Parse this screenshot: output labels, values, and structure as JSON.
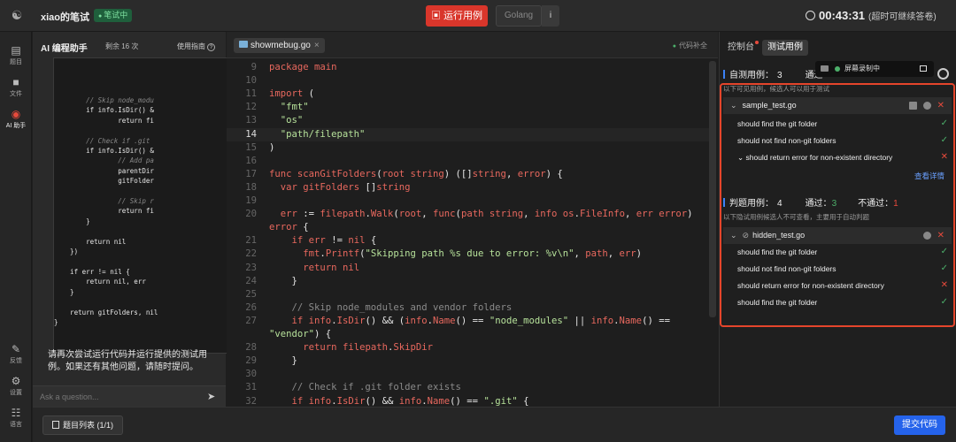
{
  "header": {
    "app_title": "xiao的笔试",
    "badge": "笔试中",
    "run_label": "运行用例",
    "language": "Golang",
    "info": "i",
    "timer": "00:43:31",
    "timer_note": "(超时可继续答卷)"
  },
  "sidebar": {
    "items": [
      {
        "label": "题目",
        "icon": "document-icon"
      },
      {
        "label": "文件",
        "icon": "folder-icon"
      },
      {
        "label": "AI 助手",
        "icon": "robot-icon"
      },
      {
        "label": "反馈",
        "icon": "feedback-icon"
      },
      {
        "label": "设置",
        "icon": "gear-icon"
      },
      {
        "label": "语言",
        "icon": "language-icon"
      }
    ]
  },
  "ai": {
    "title": "AI 编程助手",
    "remaining": "剩余 16 次",
    "guide": "使用指南",
    "code_lines": [
      {
        "text": "        // Skip node_modu",
        "cls": "c"
      },
      {
        "text": "        if info.IsDir() &",
        "cls": ""
      },
      {
        "text": "                return fi",
        "cls": ""
      },
      {
        "text": "",
        "cls": ""
      },
      {
        "text": "        // Check if .git",
        "cls": "c"
      },
      {
        "text": "        if info.IsDir() &",
        "cls": ""
      },
      {
        "text": "                // Add pa",
        "cls": "c"
      },
      {
        "text": "                parentDir",
        "cls": ""
      },
      {
        "text": "                gitFolder",
        "cls": ""
      },
      {
        "text": "",
        "cls": ""
      },
      {
        "text": "                // Skip r",
        "cls": "c"
      },
      {
        "text": "                return fi",
        "cls": ""
      },
      {
        "text": "        }",
        "cls": ""
      },
      {
        "text": "",
        "cls": ""
      },
      {
        "text": "        return nil",
        "cls": ""
      },
      {
        "text": "    })",
        "cls": ""
      },
      {
        "text": "",
        "cls": ""
      },
      {
        "text": "    if err != nil {",
        "cls": ""
      },
      {
        "text": "        return nil, err",
        "cls": ""
      },
      {
        "text": "    }",
        "cls": ""
      },
      {
        "text": "",
        "cls": ""
      },
      {
        "text": "    return gitFolders, nil",
        "cls": ""
      },
      {
        "text": "}",
        "cls": ""
      }
    ],
    "message": "请再次尝试运行代码并运行提供的测试用例。如果还有其他问题，请随时提问。",
    "input_placeholder": "Ask a question..."
  },
  "editor": {
    "tab": "showmebug.go",
    "assist": "代码补全",
    "lines": [
      {
        "n": "9",
        "html": "<span class='t-k'>package</span> <span class='t-k'>main</span>"
      },
      {
        "n": "10",
        "html": ""
      },
      {
        "n": "11",
        "html": "<span class='t-k'>import</span> ("
      },
      {
        "n": "12",
        "html": "  <span class='t-s'>\"fmt\"</span>"
      },
      {
        "n": "13",
        "html": "  <span class='t-s'>\"os\"</span>"
      },
      {
        "n": "14",
        "html": "  <span class='t-s'>\"path/filepath\"</span>",
        "hl": true
      },
      {
        "n": "15",
        "html": ")"
      },
      {
        "n": "16",
        "html": ""
      },
      {
        "n": "17",
        "html": "<span class='t-k'>func</span> <span class='t-k'>scanGitFolders</span>(<span class='t-k'>root</span> <span class='t-k'>string</span>) ([]<span class='t-k'>string</span>, <span class='t-k'>error</span>) {"
      },
      {
        "n": "18",
        "html": "  <span class='t-k'>var</span> <span class='t-k'>gitFolders</span> []<span class='t-k'>string</span>"
      },
      {
        "n": "19",
        "html": ""
      },
      {
        "n": "20",
        "html": "  <span class='t-k'>err</span> := <span class='t-k'>filepath</span>.<span class='t-k'>Walk</span>(<span class='t-k'>root</span>, <span class='t-k'>func</span>(<span class='t-k'>path</span> <span class='t-k'>string</span>, <span class='t-k'>info</span> <span class='t-k'>os</span>.<span class='t-k'>FileInfo</span>, <span class='t-k'>err</span> <span class='t-k'>error</span>)"
      },
      {
        "n": "",
        "html": "<span class='t-k'>error</span> {"
      },
      {
        "n": "21",
        "html": "    <span class='t-k'>if</span> <span class='t-k'>err</span> != <span class='t-k'>nil</span> {"
      },
      {
        "n": "22",
        "html": "      <span class='t-k'>fmt</span>.<span class='t-k'>Printf</span>(<span class='t-s'>\"Skipping path %s due to error: %v\\n\"</span>, <span class='t-k'>path</span>, <span class='t-k'>err</span>)"
      },
      {
        "n": "23",
        "html": "      <span class='t-k'>return</span> <span class='t-k'>nil</span>"
      },
      {
        "n": "24",
        "html": "    }"
      },
      {
        "n": "25",
        "html": ""
      },
      {
        "n": "26",
        "html": "    <span class='t-c'>// Skip node_modules and vendor folders</span>"
      },
      {
        "n": "27",
        "html": "    <span class='t-k'>if</span> <span class='t-k'>info</span>.<span class='t-k'>IsDir</span>() &amp;&amp; (<span class='t-k'>info</span>.<span class='t-k'>Name</span>() == <span class='t-s'>\"node_modules\"</span> || <span class='t-k'>info</span>.<span class='t-k'>Name</span>() =="
      },
      {
        "n": "",
        "html": "<span class='t-s'>\"vendor\"</span>) {"
      },
      {
        "n": "28",
        "html": "      <span class='t-k'>return</span> <span class='t-k'>filepath</span>.<span class='t-k'>SkipDir</span>"
      },
      {
        "n": "29",
        "html": "    }"
      },
      {
        "n": "30",
        "html": ""
      },
      {
        "n": "31",
        "html": "    <span class='t-c'>// Check if .git folder exists</span>"
      },
      {
        "n": "32",
        "html": "    <span class='t-k'>if</span> <span class='t-k'>info</span>.<span class='t-k'>IsDir</span>() &amp;&amp; <span class='t-k'>info</span>.<span class='t-k'>Name</span>() == <span class='t-s'>\".git\"</span> {"
      }
    ]
  },
  "right": {
    "tab_console": "控制台",
    "tab_tests": "测试用例",
    "self_label": "自测用例：",
    "self_count": "3",
    "self_pass_label": "通过",
    "self_note": "以下可见用例，候选人可以用于测试",
    "recording": "屏幕录制中",
    "sample_file": "sample_test.go",
    "sample_cases": [
      {
        "name": "should find the git folder",
        "status": "ok"
      },
      {
        "name": "should not find non-git folders",
        "status": "ok"
      },
      {
        "name": "should return error for non-existent directory",
        "status": "bad"
      }
    ],
    "detail": "查看详情",
    "judge_label": "判题用例：",
    "judge_count": "4",
    "judge_pass_label": "通过：",
    "judge_pass": "3",
    "judge_fail_label": "不通过：",
    "judge_fail": "1",
    "judge_note": "以下隐试用例候选人不可查看，主要用于自动判题",
    "hidden_file": "hidden_test.go",
    "hidden_cases": [
      {
        "name": "should find the git folder",
        "status": "ok"
      },
      {
        "name": "should not find non-git folders",
        "status": "ok"
      },
      {
        "name": "should return error for non-existent directory",
        "status": "bad"
      },
      {
        "name": "should find the git folder",
        "status": "ok"
      }
    ]
  },
  "footer": {
    "question_list": "题目列表 (1/1)",
    "submit": "提交代码"
  }
}
